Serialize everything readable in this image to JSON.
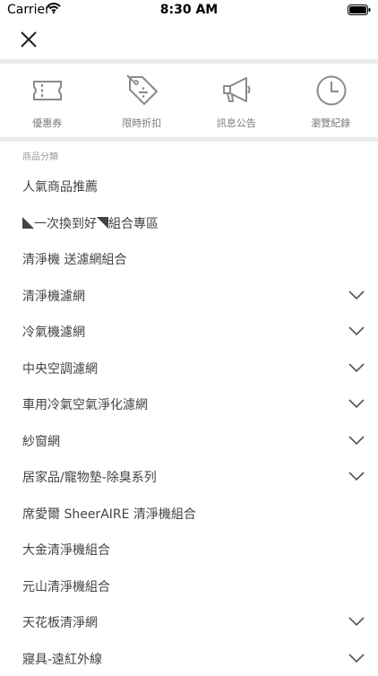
{
  "status_bar": {
    "carrier": "Carrier",
    "time": "8:30 AM"
  },
  "quick_actions": [
    {
      "label": "優惠券",
      "icon": "ticket-icon"
    },
    {
      "label": "限時折扣",
      "icon": "discount-tag-icon"
    },
    {
      "label": "訊息公告",
      "icon": "megaphone-icon"
    },
    {
      "label": "瀏覽紀錄",
      "icon": "clock-icon"
    }
  ],
  "section_title": "商品分類",
  "categories": [
    {
      "label": "人氣商品推薦",
      "expandable": false
    },
    {
      "label_part1": "一次換到好",
      "label_part2": "組合專區",
      "expandable": false
    },
    {
      "label": "清淨機 送濾網組合",
      "expandable": false
    },
    {
      "label": "清淨機濾網",
      "expandable": true
    },
    {
      "label": "冷氣機濾網",
      "expandable": true
    },
    {
      "label": "中央空調濾網",
      "expandable": true
    },
    {
      "label": "車用冷氣空氣淨化濾網",
      "expandable": true
    },
    {
      "label": "紗窗網",
      "expandable": true
    },
    {
      "label": "居家品/寵物墊-除臭系列",
      "expandable": true
    },
    {
      "label": "席愛爾 SheerAIRE 清淨機組合",
      "expandable": false
    },
    {
      "label": "大金清淨機組合",
      "expandable": false
    },
    {
      "label": "元山清淨機組合",
      "expandable": false
    },
    {
      "label": "天花板清淨網",
      "expandable": true
    },
    {
      "label": "寢具-遠紅外線",
      "expandable": true
    }
  ],
  "colors": {
    "icon": "#8a8a8a",
    "divider": "#ececec",
    "text": "#444444",
    "muted": "#9a9a9a"
  }
}
